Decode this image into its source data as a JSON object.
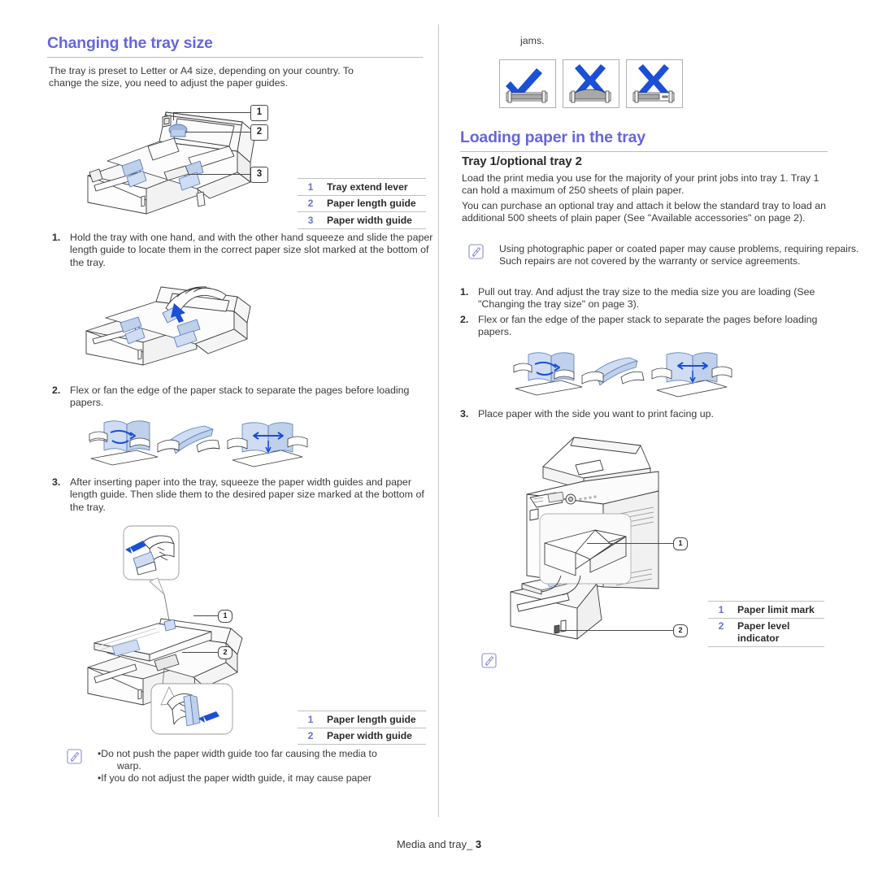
{
  "document": {
    "footer_label": "Media and tray_",
    "footer_page": "3"
  },
  "left_column": {
    "heading": "Changing the tray size",
    "intro": "The tray is preset to Letter or A4 size, depending on your country. To change the size, you need to adjust the paper guides.",
    "figure_tray_callouts": [
      "1",
      "2",
      "3"
    ],
    "legend_top": {
      "rows": [
        {
          "num": "1",
          "label": "Tray extend lever"
        },
        {
          "num": "2",
          "label": "Paper length guide"
        },
        {
          "num": "3",
          "label": "Paper width guide"
        }
      ]
    },
    "steps": [
      {
        "num": "1.",
        "text": "Hold the tray with one hand, and with the other hand squeeze and slide the paper length guide to locate them in the correct paper size slot marked at the bottom of the tray."
      },
      {
        "num": "2.",
        "text": "Flex or fan the edge of the paper stack to separate the pages before loading papers."
      },
      {
        "num": "3.",
        "text": "After inserting paper into the tray, squeeze the paper width guides and paper length guide. Then slide them to the desired paper size marked at the bottom of the tray."
      }
    ],
    "figure_insert_callouts": [
      "1",
      "2"
    ],
    "legend_bottom": {
      "rows": [
        {
          "num": "1",
          "label": "Paper length guide"
        },
        {
          "num": "2",
          "label": "Paper width guide"
        }
      ]
    },
    "note": {
      "icon": "note-pencil-icon",
      "bullets": [
        {
          "text": "Do not push the paper width guide too far causing the media to",
          "continuation": "warp."
        },
        {
          "text": "If you do not adjust the paper width guide, it may cause paper",
          "continuation": ""
        }
      ]
    }
  },
  "right_column": {
    "continued_text": "jams.",
    "mark_boxes": [
      {
        "mark": "check",
        "icon": "check-mark-icon"
      },
      {
        "mark": "cross",
        "icon": "cross-mark-icon"
      },
      {
        "mark": "cross",
        "icon": "cross-mark-icon"
      }
    ],
    "heading": "Loading paper in the tray",
    "subheading": "Tray 1/optional tray 2",
    "paragraphs": [
      "Load the print media you use for the majority of your print jobs into tray 1. Tray 1 can hold a maximum of 250 sheets of plain paper.",
      "You can purchase an optional tray and attach it below the standard tray to load an additional 500 sheets of plain paper (See \"Available accessories\" on page 2)."
    ],
    "note": {
      "icon": "note-pencil-icon",
      "text": "Using photographic paper or coated paper may cause problems, requiring repairs. Such repairs are not covered by the warranty or service agreements."
    },
    "steps": [
      {
        "num": "1.",
        "text": "Pull out tray. And adjust the tray size to the media size you are loading (See \"Changing the tray size\" on page 3)."
      },
      {
        "num": "2.",
        "text": "Flex or fan the edge of the paper stack to separate the pages before loading papers."
      },
      {
        "num": "3.",
        "text": "Place paper with the side you want to print facing up."
      }
    ],
    "figure_printer_callouts": [
      "1",
      "2"
    ],
    "legend": {
      "rows": [
        {
          "num": "1",
          "label": "Paper limit mark"
        },
        {
          "num": "2",
          "label": "Paper level\nindicator"
        }
      ]
    },
    "trailing_note_icon": "note-pencil-icon"
  },
  "colors": {
    "heading": "#6666dd",
    "legend_number": "#6f6fd8",
    "body_text": "#3a3a3a",
    "accent_blue": "#1a4fd6",
    "paper_fill": "#cfdcf2"
  }
}
